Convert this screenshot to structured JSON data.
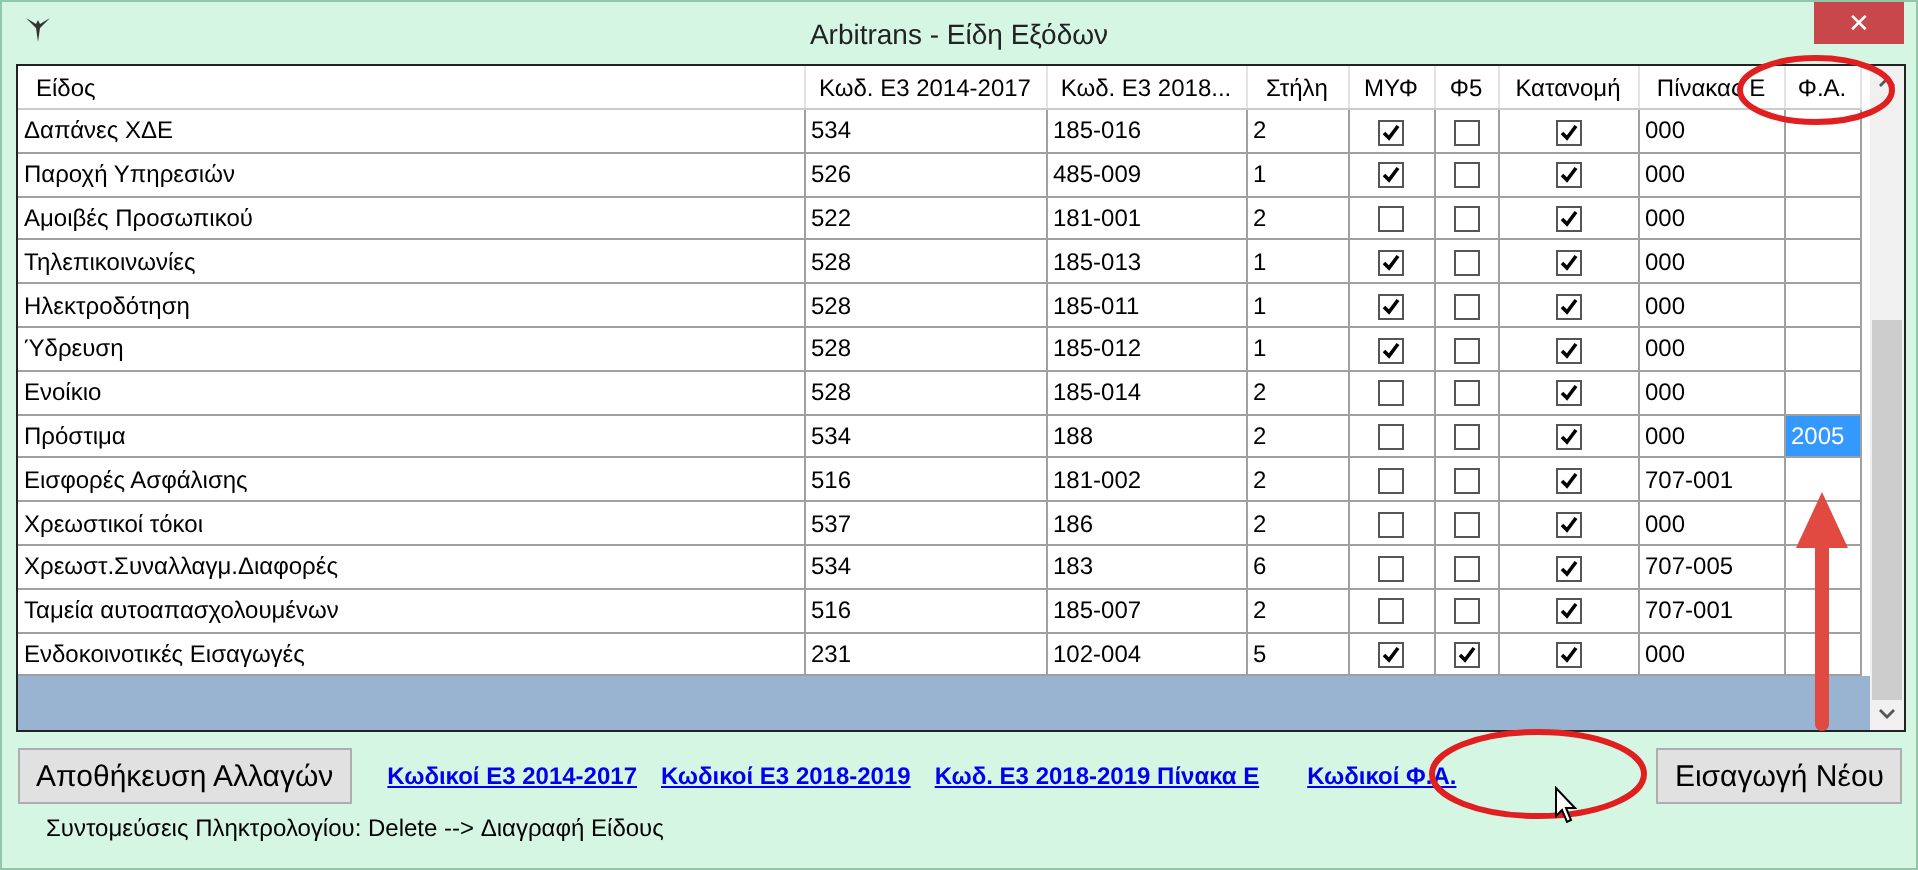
{
  "window": {
    "title": "Arbitrans - Είδη Εξόδων",
    "close": "✕"
  },
  "table": {
    "columns": [
      "Είδος",
      "Κωδ. Ε3 2014-2017",
      "Κωδ. Ε3 2018...",
      "Στήλη",
      "ΜΥΦ",
      "Φ5",
      "Κατανομή",
      "Πίνακας Ε",
      "Φ.Α."
    ],
    "rows": [
      {
        "name": "Δαπάνες ΧΔΕ",
        "code_2014": "534",
        "code_2018": "185-016",
        "column": "2",
        "myf": true,
        "f5": false,
        "allocation": true,
        "table_e": "000"
      },
      {
        "name": "Παροχή Υπηρεσιών",
        "code_2014": "526",
        "code_2018": "485-009",
        "column": "1",
        "myf": true,
        "f5": false,
        "allocation": true,
        "table_e": "000"
      },
      {
        "name": "Αμοιβές Προσωπικού",
        "code_2014": "522",
        "code_2018": "181-001",
        "column": "2",
        "myf": false,
        "f5": false,
        "allocation": true,
        "table_e": "000"
      },
      {
        "name": "Τηλεπικοινωνίες",
        "code_2014": "528",
        "code_2018": "185-013",
        "column": "1",
        "myf": true,
        "f5": false,
        "allocation": true,
        "table_e": "000"
      },
      {
        "name": "Ηλεκτροδότηση",
        "code_2014": "528",
        "code_2018": "185-011",
        "column": "1",
        "myf": true,
        "f5": false,
        "allocation": true,
        "table_e": "000"
      },
      {
        "name": "Ύδρευση",
        "code_2014": "528",
        "code_2018": "185-012",
        "column": "1",
        "myf": true,
        "f5": false,
        "allocation": true,
        "table_e": "000"
      },
      {
        "name": "Ενοίκιο",
        "code_2014": "528",
        "code_2018": "185-014",
        "column": "2",
        "myf": false,
        "f5": false,
        "allocation": true,
        "table_e": "000"
      },
      {
        "name": "Πρόστιμα",
        "code_2014": "534",
        "code_2018": "188",
        "column": "2",
        "myf": false,
        "f5": false,
        "allocation": true,
        "table_e": "000",
        "fa": "2005",
        "fa_selected": true
      },
      {
        "name": "Εισφορές Ασφάλισης",
        "code_2014": "516",
        "code_2018": "181-002",
        "column": "2",
        "myf": false,
        "f5": false,
        "allocation": true,
        "table_e": "707-001"
      },
      {
        "name": "Χρεωστικοί τόκοι",
        "code_2014": "537",
        "code_2018": "186",
        "column": "2",
        "myf": false,
        "f5": false,
        "allocation": true,
        "table_e": "000"
      },
      {
        "name": "Χρεωστ.Συναλλαγμ.Διαφορές",
        "code_2014": "534",
        "code_2018": "183",
        "column": "6",
        "myf": false,
        "f5": false,
        "allocation": true,
        "table_e": "707-005"
      },
      {
        "name": "Ταμεία αυτοαπασχολουμένων",
        "code_2014": "516",
        "code_2018": "185-007",
        "column": "2",
        "myf": false,
        "f5": false,
        "allocation": true,
        "table_e": "707-001"
      },
      {
        "name": "Ενδοκοινοτικές Εισαγωγές",
        "code_2014": "231",
        "code_2018": "102-004",
        "column": "5",
        "myf": true,
        "f5": true,
        "allocation": true,
        "table_e": "000"
      }
    ]
  },
  "save_button": "Αποθήκευση Αλλαγών",
  "links": [
    "Κωδικοί Ε3 2014-2017",
    "Κωδικοί Ε3 2018-2019",
    "Κωδ. Ε3 2018-2019 Πίνακα Ε",
    "Κωδικοί Φ.Α."
  ],
  "new_button": "Εισαγωγή Νέου",
  "shortcuts": "Συντομεύσεις Πληκτρολογίου: Delete --> Διαγραφή Είδους"
}
